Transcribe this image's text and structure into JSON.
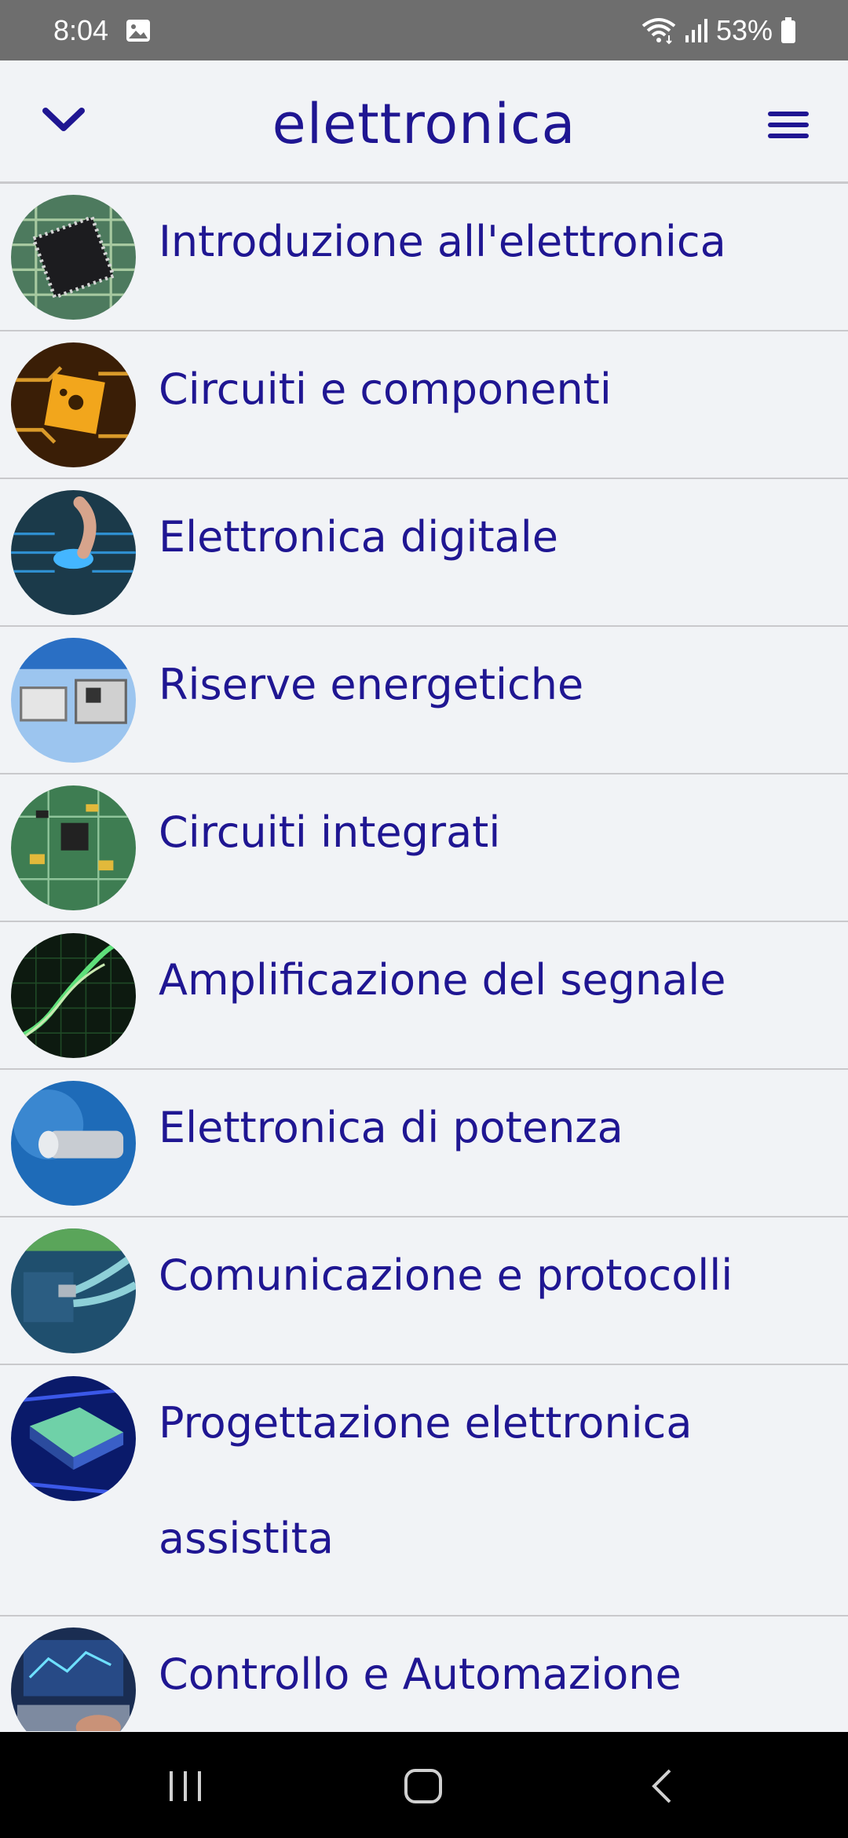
{
  "status_bar": {
    "time": "8:04",
    "battery": "53%",
    "icons": [
      "gallery-icon",
      "wifi-icon",
      "signal-icon",
      "battery-icon"
    ]
  },
  "header": {
    "title": "elettronica",
    "back_icon": "chevron-down-icon",
    "menu_icon": "hamburger-menu-icon"
  },
  "topics": [
    {
      "label": "Introduzione all'elettronica"
    },
    {
      "label": "Circuiti e componenti"
    },
    {
      "label": "Elettronica digitale"
    },
    {
      "label": "Riserve energetiche"
    },
    {
      "label": "Circuiti integrati"
    },
    {
      "label": "Amplificazione del segnale"
    },
    {
      "label": "Elettronica di potenza"
    },
    {
      "label": "Comunicazione e protocolli"
    },
    {
      "label": "Progettazione elettronica assistita"
    },
    {
      "label": "Controllo e Automazione"
    }
  ],
  "nav_bar": {
    "icons": [
      "recent-apps-icon",
      "home-icon",
      "back-icon"
    ]
  },
  "colors": {
    "accent": "#1f1692",
    "background": "#f1f3f6",
    "status_bar": "#6e6e6e",
    "nav_bar": "#000000"
  }
}
